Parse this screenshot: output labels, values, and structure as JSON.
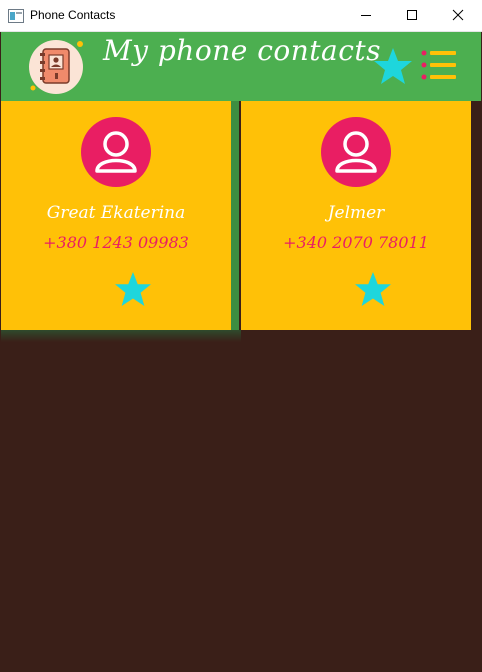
{
  "window": {
    "title": "Phone Contacts",
    "controls": [
      "minimize",
      "maximize",
      "close"
    ]
  },
  "header": {
    "title": "My phone contacts",
    "logo_icon": "address-book-icon",
    "favorites_icon": "star-icon",
    "menu_icon": "menu-icon"
  },
  "contacts": [
    {
      "name": "Great Ekaterina",
      "phone": "+380 1243 09983",
      "avatar_icon": "user-icon",
      "favorite_icon": "star-icon"
    },
    {
      "name": "Jelmer",
      "phone": "+340 2070 78011",
      "avatar_icon": "user-icon",
      "favorite_icon": "star-icon"
    }
  ],
  "colors": {
    "header_bg": "#4caf50",
    "card_bg": "#ffc107",
    "avatar_bg": "#e91e63",
    "star": "#1ed6dc",
    "menu_dot": "#e91e63",
    "menu_line": "#ffc107",
    "page_bg": "#3a1f18"
  }
}
